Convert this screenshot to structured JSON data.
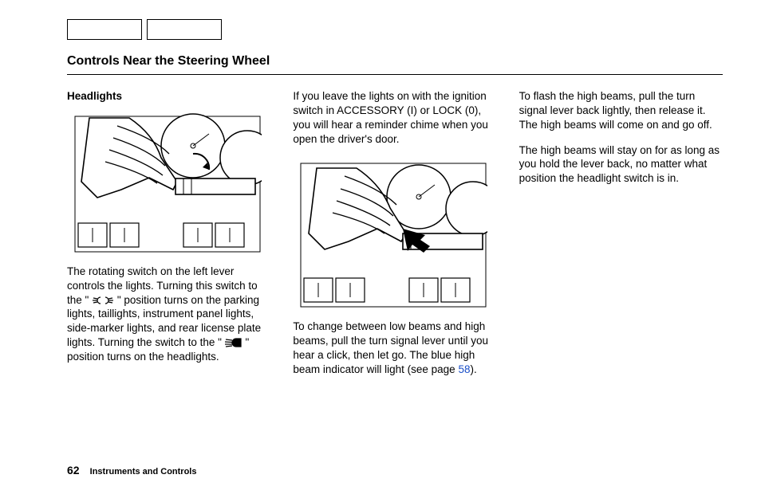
{
  "header": {
    "title": "Controls Near the Steering Wheel"
  },
  "col1": {
    "subhead": "Headlights",
    "p1a": "The rotating switch on the left lever controls the lights. Turning this switch to the \"",
    "p1b": "\" position turns on the parking lights, taillights, instrument panel lights, side-marker lights, and rear license plate lights. Turning the switch to the \"",
    "p1c": "\" position turns on the headlights."
  },
  "col2": {
    "p1": "If you leave the lights on with the ignition switch in ACCESSORY (I) or LOCK (0), you will hear a reminder chime when you open the driver's door.",
    "p2a": "To change between low beams and high beams, pull the turn signal lever until you hear a click, then let go. The blue high beam indicator will light (see page ",
    "p2link": "58",
    "p2b": ")."
  },
  "col3": {
    "p1": "To flash the high beams, pull the turn signal lever back lightly, then release it. The high beams will come on and go off.",
    "p2": "The high beams will stay on for as long as you hold the lever back, no matter what position the headlight switch is in."
  },
  "footer": {
    "page": "62",
    "section": "Instruments and Controls"
  }
}
